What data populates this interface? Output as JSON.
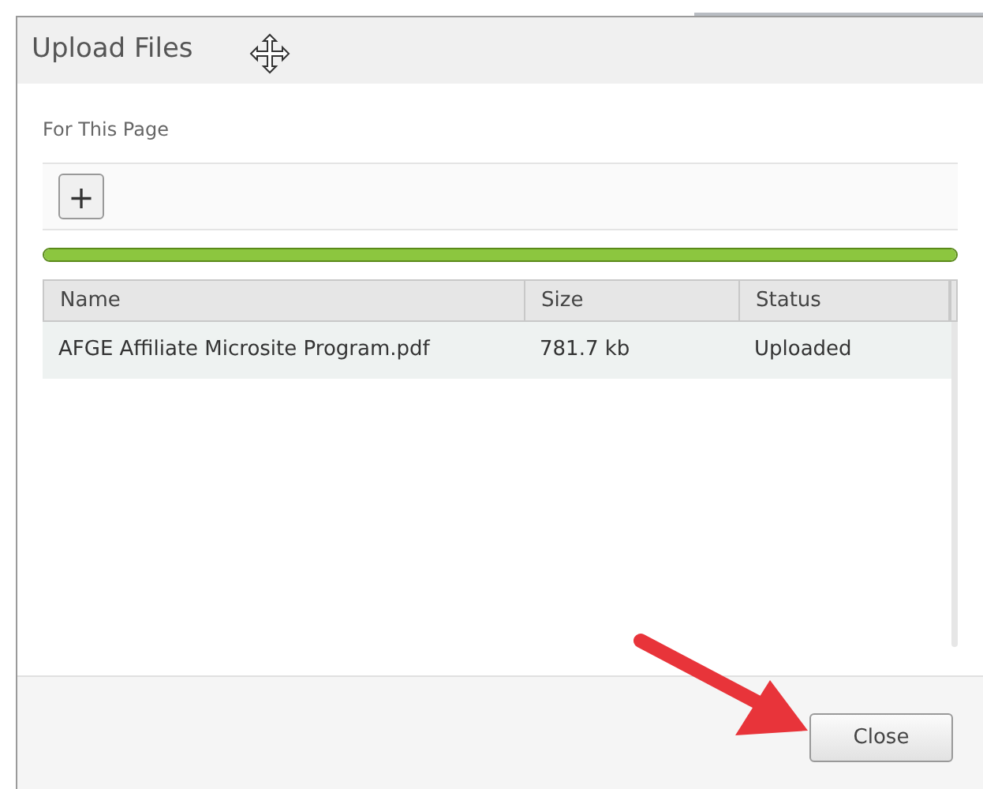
{
  "dialog": {
    "title": "Upload Files",
    "section_label": "For This Page",
    "add_button": "+"
  },
  "progress": {
    "level": 1
  },
  "table": {
    "columns": [
      "Name",
      "Size",
      "Status"
    ],
    "rows": [
      {
        "cells": [
          "AFGE Affiliate Microsite Program.pdf",
          "781.7 kb",
          "Uploaded"
        ]
      }
    ]
  },
  "buttons": [
    "Close"
  ]
}
